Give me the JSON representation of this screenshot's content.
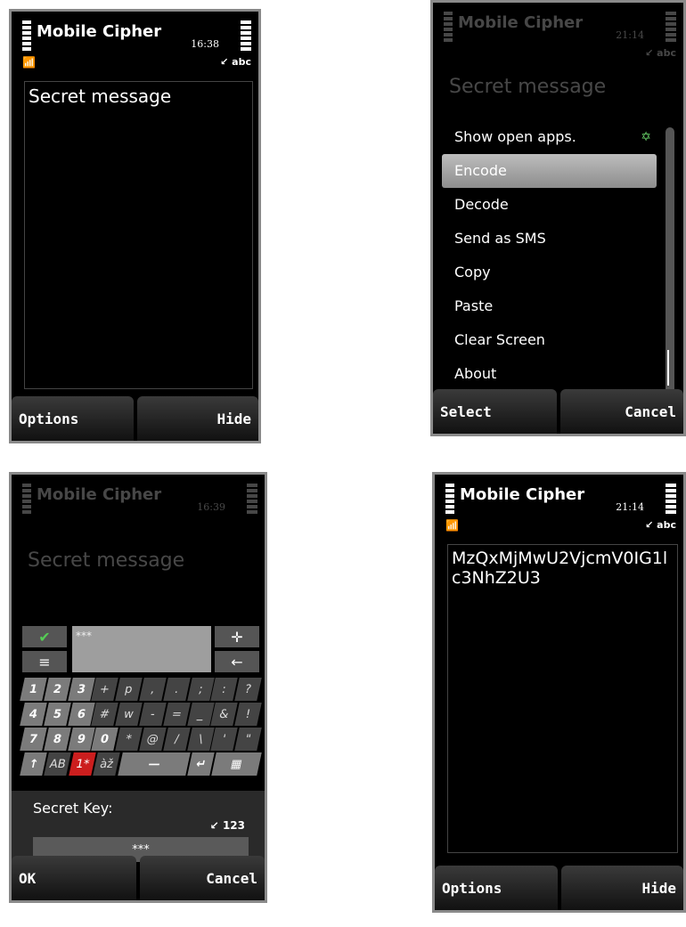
{
  "app_title": "Mobile Cipher",
  "screen1": {
    "time": "16:38",
    "indicator": "↙ abc",
    "editor_text": "Secret message",
    "softkey_left": "Options",
    "softkey_right": "Hide"
  },
  "screen2": {
    "time": "21:14",
    "indicator": "↙ abc",
    "editor_text": "Secret message",
    "menu_items": [
      "Show open apps.",
      "Encode",
      "Decode",
      "Send as SMS",
      "Copy",
      "Paste",
      "Clear Screen",
      "About"
    ],
    "selected_index": 1,
    "softkey_left": "Select",
    "softkey_right": "Cancel"
  },
  "screen3": {
    "time": "16:39",
    "editor_text": "Secret message",
    "field_text": "***",
    "rows": [
      [
        "1",
        "2",
        "3",
        "+",
        "p",
        ",",
        ".",
        ";",
        ":",
        "?"
      ],
      [
        "4",
        "5",
        "6",
        "#",
        "w",
        "-",
        "=",
        "_",
        "&",
        "!"
      ],
      [
        "7",
        "8",
        "9",
        "0",
        "*",
        "@",
        "/",
        "\\",
        "'",
        "\""
      ]
    ],
    "bottom_row": [
      "↑",
      "AB",
      "1*",
      "àž",
      "—",
      "↵",
      "▦"
    ],
    "key_label": "Secret Key:",
    "mode": "↙ 123",
    "key_value": "***",
    "softkey_left": "OK",
    "softkey_right": "Cancel"
  },
  "screen4": {
    "time": "21:14",
    "indicator": "↙ abc",
    "editor_text": "MzQxMjMwU2VjcmV0IG1lc3NhZ2U3",
    "softkey_left": "Options",
    "softkey_right": "Hide"
  }
}
